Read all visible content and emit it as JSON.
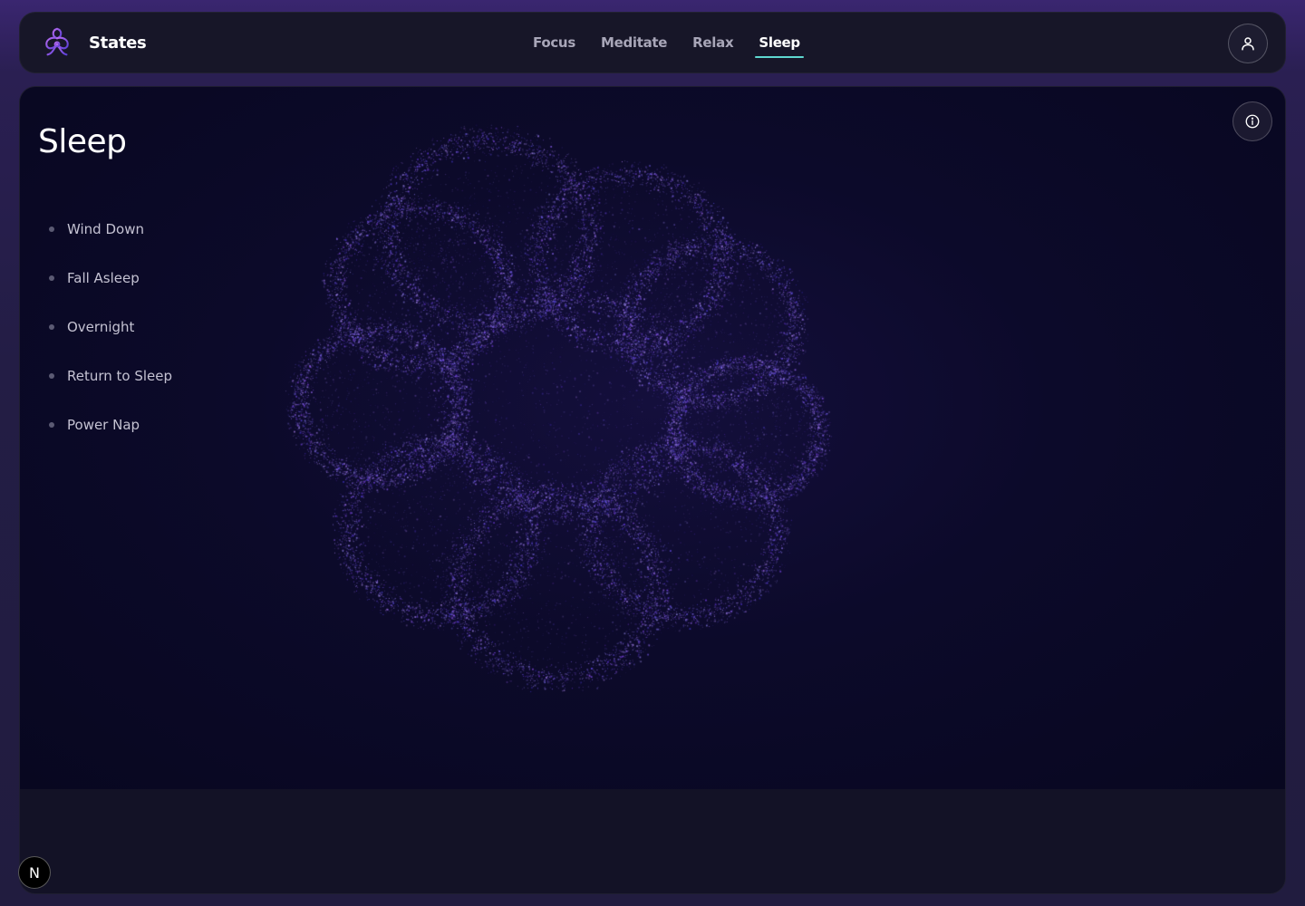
{
  "brand": {
    "name": "States",
    "logo_icon": "lotus-knot-icon",
    "accent": "#7a4fd8"
  },
  "nav": {
    "tabs": [
      {
        "label": "Focus",
        "active": false
      },
      {
        "label": "Meditate",
        "active": false
      },
      {
        "label": "Relax",
        "active": false
      },
      {
        "label": "Sleep",
        "active": true
      }
    ],
    "active_underline_color": "#5fd8d0"
  },
  "header": {
    "user_icon": "user-icon"
  },
  "page": {
    "title": "Sleep",
    "menu": [
      {
        "label": "Wind Down"
      },
      {
        "label": "Fall Asleep"
      },
      {
        "label": "Overnight"
      },
      {
        "label": "Return to Sleep"
      },
      {
        "label": "Power Nap"
      }
    ],
    "info_icon": "info-icon",
    "visual": "particle-cloud",
    "particle_color": "#6a52e0"
  },
  "badge": {
    "label": "N"
  }
}
